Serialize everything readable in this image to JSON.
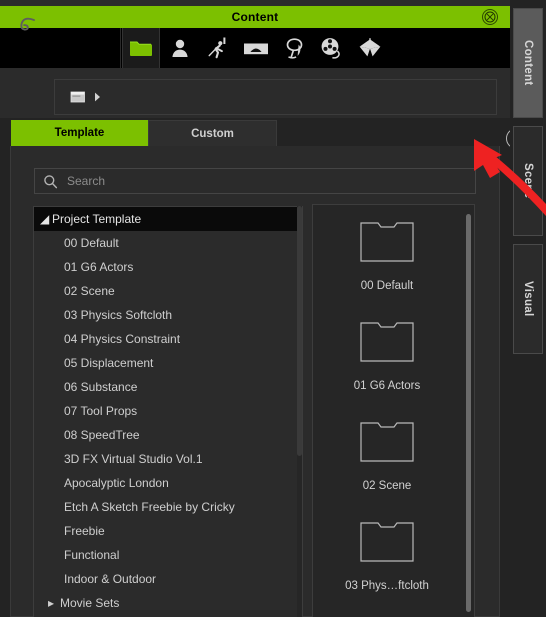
{
  "window": {
    "title": "Content",
    "close_icon": "close-circle-icon",
    "accent_color": "#7cc000",
    "background_color": "#2b2b2b"
  },
  "icon_toolbar": {
    "items": [
      {
        "name": "folder-icon",
        "label": "Folder",
        "selected": true
      },
      {
        "name": "avatar-icon",
        "label": "Actor",
        "selected": false
      },
      {
        "name": "motion-icon",
        "label": "Motion",
        "selected": false
      },
      {
        "name": "scene-icon",
        "label": "Scene",
        "selected": false
      },
      {
        "name": "tree-icon",
        "label": "Vegetation",
        "selected": false
      },
      {
        "name": "film-reel-icon",
        "label": "Media",
        "selected": false
      },
      {
        "name": "umbrella-icon",
        "label": "Props",
        "selected": false
      }
    ]
  },
  "breadcrumb": {
    "back_icon": "back-arrow-icon",
    "folder_icon": "folder-small-icon",
    "separator_icon": "chevron-right-icon",
    "path": ""
  },
  "tabs": {
    "items": [
      {
        "label": "Template",
        "active": true
      },
      {
        "label": "Custom",
        "active": false
      }
    ],
    "expand_icon": "chevron-down-circle-icon"
  },
  "search": {
    "placeholder": "Search",
    "value": "",
    "icon": "search-icon"
  },
  "tree": {
    "root": {
      "label": "Project Template",
      "expanded": true,
      "selected": true,
      "triangle": "◢"
    },
    "items": [
      {
        "label": "00 Default",
        "type": "leaf"
      },
      {
        "label": "01 G6 Actors",
        "type": "leaf"
      },
      {
        "label": "02 Scene",
        "type": "leaf"
      },
      {
        "label": "03 Physics Softcloth",
        "type": "leaf"
      },
      {
        "label": "04 Physics Constraint",
        "type": "leaf"
      },
      {
        "label": "05 Displacement",
        "type": "leaf"
      },
      {
        "label": "06 Substance",
        "type": "leaf"
      },
      {
        "label": "07 Tool Props",
        "type": "leaf"
      },
      {
        "label": "08 SpeedTree",
        "type": "leaf"
      },
      {
        "label": "3D FX Virtual Studio Vol.1",
        "type": "leaf"
      },
      {
        "label": "Apocalyptic London",
        "type": "leaf"
      },
      {
        "label": "Etch A Sketch Freebie by Cricky",
        "type": "leaf"
      },
      {
        "label": "Freebie",
        "type": "leaf"
      },
      {
        "label": "Functional",
        "type": "leaf"
      },
      {
        "label": "Indoor & Outdoor",
        "type": "leaf"
      },
      {
        "label": "Movie Sets",
        "type": "branch",
        "triangle": "▸"
      }
    ]
  },
  "thumbnails": {
    "items": [
      {
        "label": "00 Default",
        "icon": "folder-outline-icon"
      },
      {
        "label": "01 G6 Actors",
        "icon": "folder-outline-icon"
      },
      {
        "label": "02 Scene",
        "icon": "folder-outline-icon"
      },
      {
        "label": "03 Phys…ftcloth",
        "icon": "folder-outline-icon"
      }
    ]
  },
  "dock": {
    "tabs": [
      {
        "label": "Content",
        "selected": true
      },
      {
        "label": "Scene",
        "selected": false
      },
      {
        "label": "Visual",
        "selected": false
      }
    ]
  },
  "annotation": {
    "type": "arrow",
    "color": "#ee2222",
    "points_to": "chevron-down-circle-icon"
  }
}
